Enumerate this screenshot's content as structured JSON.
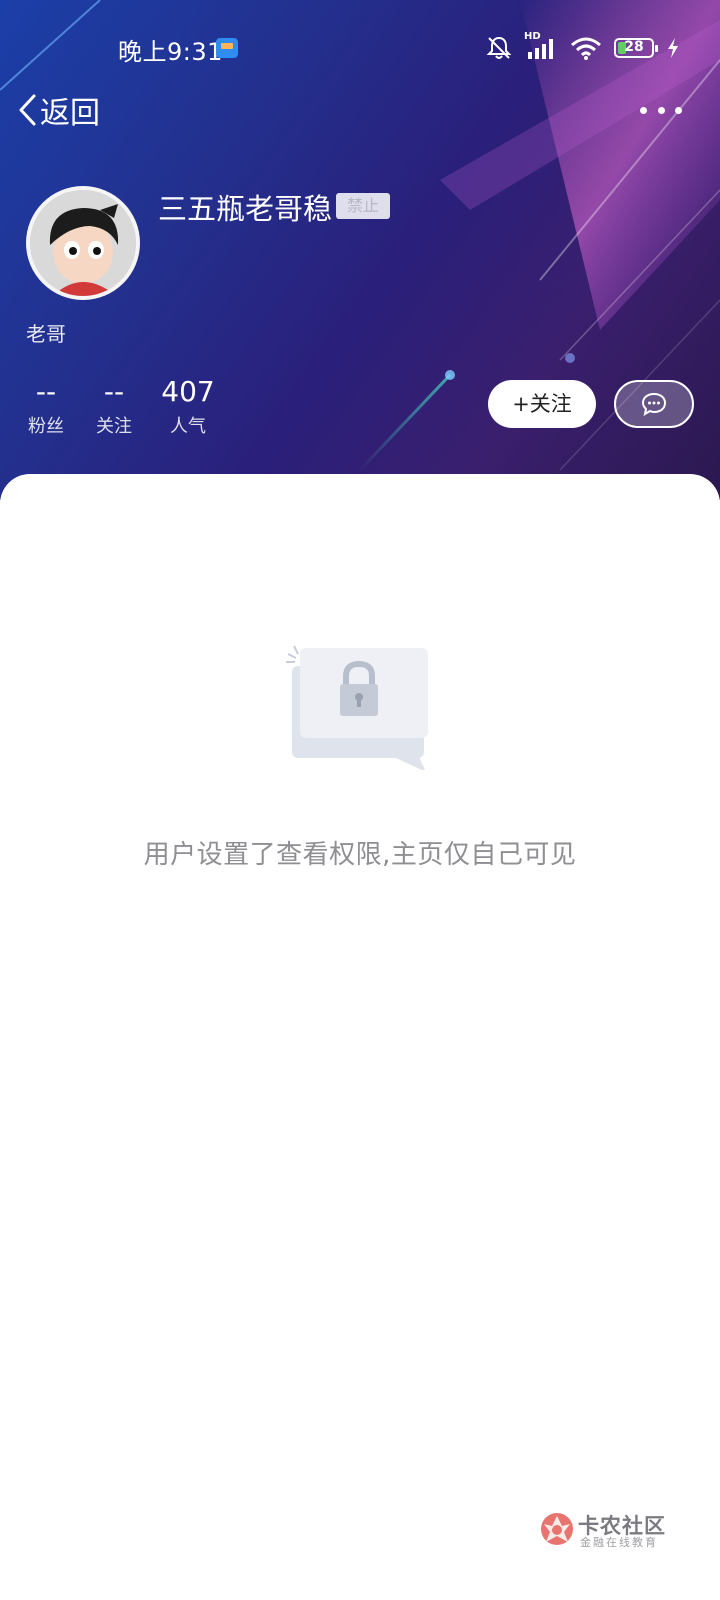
{
  "status_bar": {
    "time": "晚上9:31",
    "network_label": "HD",
    "battery_level": "28",
    "icons": [
      "calendar-app-icon",
      "bell-muted-icon",
      "signal-icon",
      "wifi-icon",
      "battery-icon",
      "charging-icon"
    ]
  },
  "nav": {
    "back_label": "返回",
    "more_icon": "more-dots-icon"
  },
  "profile": {
    "username": "三五瓶老哥稳",
    "badge": "禁止",
    "tagline": "老哥",
    "stats": [
      {
        "value": "--",
        "label": "粉丝"
      },
      {
        "value": "--",
        "label": "关注"
      },
      {
        "value": "407",
        "label": "人气"
      }
    ],
    "follow_label": "+关注",
    "message_icon": "chat-bubble-icon"
  },
  "content": {
    "empty_icon": "locked-card-icon",
    "empty_message": "用户设置了查看权限,主页仅自己可见"
  },
  "watermark": {
    "title": "卡农社区",
    "subtitle": "金融在线教育"
  },
  "colors": {
    "header_gradient_start": "#1b3fa8",
    "header_gradient_end": "#2b184f",
    "empty_text": "#8e8e93"
  }
}
